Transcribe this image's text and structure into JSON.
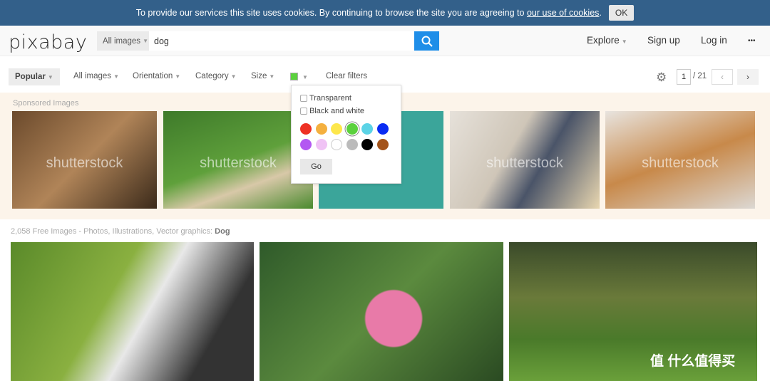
{
  "cookie": {
    "text": "To provide our services this site uses cookies. By continuing to browse the site you are agreeing to",
    "link": "our use of cookies",
    "after": ".",
    "ok": "OK"
  },
  "header": {
    "logo": "pixabay",
    "type_select": "All images",
    "search_value": "dog",
    "nav": [
      "Explore",
      "Sign up",
      "Log in"
    ],
    "more": "•••"
  },
  "filters": {
    "sort": "Popular",
    "items": [
      "All images",
      "Orientation",
      "Category",
      "Size"
    ],
    "color": "#5bd13d",
    "clear": "Clear filters",
    "page": "1",
    "pages": "/ 21",
    "prev": "‹",
    "next": "›"
  },
  "color_popup": {
    "transparent": "Transparent",
    "bw": "Black and white",
    "colors": [
      "#ee3124",
      "#f4b03f",
      "#fde74c",
      "#5bd13d",
      "#5bd3e6",
      "#0a2cf3",
      "#b358f2",
      "#f0c3f5",
      "#ffffff",
      "#bbbbbb",
      "#000000",
      "#a3531a"
    ],
    "selected": "#5bd13d",
    "go": "Go"
  },
  "sponsored": {
    "label": "Sponsored Images",
    "watermark": "shutterstock"
  },
  "results": {
    "count_text": "2,058 Free Images - Photos, Illustrations, Vector graphics:",
    "query": "Dog"
  },
  "corner_logo": "值 什么值得买"
}
